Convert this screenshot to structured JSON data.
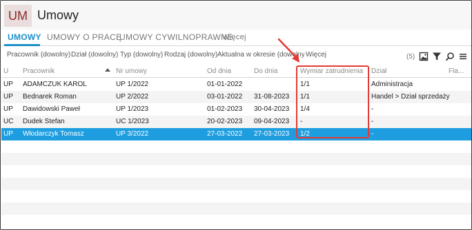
{
  "app": {
    "badge": "UM",
    "title": "Umowy"
  },
  "tabs": [
    {
      "label": "UMOWY",
      "active": true
    },
    {
      "label": "UMOWY O PRACĘ",
      "active": false
    },
    {
      "label": "UMOWY CYWILNOPRAWNE",
      "active": false
    },
    {
      "label": "Więcej",
      "active": false
    }
  ],
  "filters": {
    "items": [
      "Pracownik (dowolny)",
      "Dział (dowolny)",
      "Typ (dowolny)",
      "Rodzaj (dowolny)",
      "Aktualna w okresie (dowolny)",
      "Więcej"
    ],
    "count": "(5)"
  },
  "table": {
    "columns": [
      "U",
      "Pracownik",
      "Nr umowy",
      "Od dnia",
      "Do dnia",
      "Wymiar zatrudnienia",
      "Dział",
      "Fla..."
    ],
    "rows": [
      {
        "cells": [
          "UP",
          "ADAMCZUK KAROL",
          "UP 1/2022",
          "01-01-2022",
          "",
          "1/1",
          "Administracja",
          ""
        ],
        "selected": false
      },
      {
        "cells": [
          "UP",
          "Bednarek Roman",
          "UP 2/2022",
          "03-01-2022",
          "31-08-2023",
          "1/1",
          "Handel > Dział sprzedaży",
          ""
        ],
        "selected": false
      },
      {
        "cells": [
          "UP",
          "Dawidowski Paweł",
          "UP 1/2023",
          "01-02-2023",
          "30-04-2023",
          "1/4",
          "-",
          ""
        ],
        "selected": false
      },
      {
        "cells": [
          "UC",
          "Dudek Stefan",
          "UC 1/2023",
          "20-02-2023",
          "09-04-2023",
          "-",
          "-",
          ""
        ],
        "selected": false
      },
      {
        "cells": [
          "UP",
          "Włodarczyk Tomasz",
          "UP 3/2022",
          "27-03-2022",
          "27-03-2023",
          "1/2",
          "-",
          ""
        ],
        "selected": true
      }
    ]
  },
  "colors": {
    "accent": "#1b8fc7",
    "selected_row": "#1e9ee0",
    "highlight": "#e53935",
    "badge_bg": "#e9dddd",
    "badge_text": "#8a2b2b"
  },
  "icons": [
    "image-export-icon",
    "filter-icon",
    "search-icon",
    "menu-icon",
    "sort-up-icon",
    "annotation-arrow-icon"
  ]
}
